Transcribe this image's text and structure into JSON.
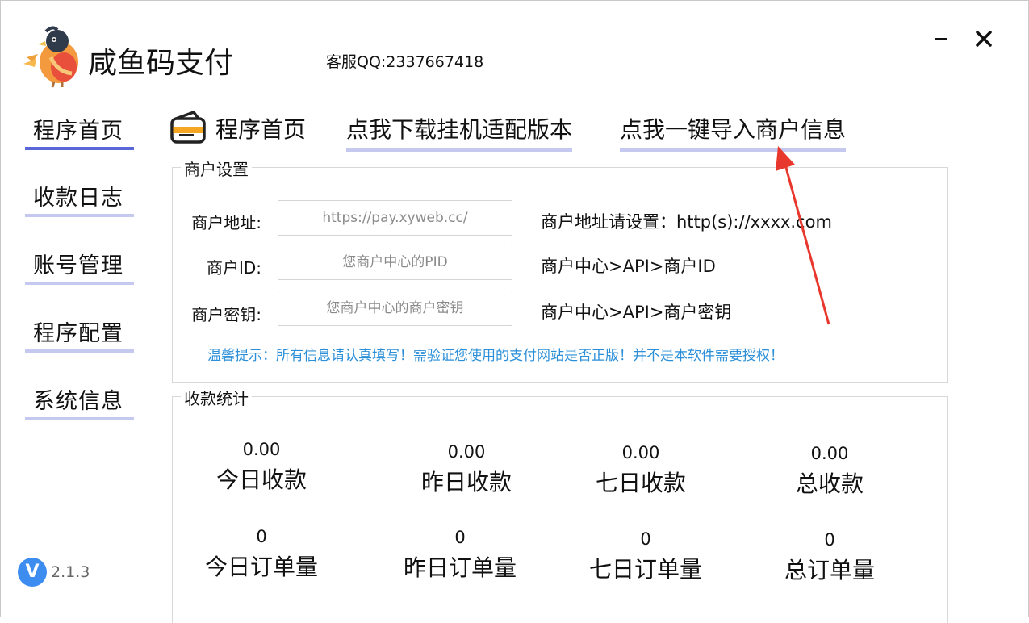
{
  "app": {
    "title": "咸鱼码支付",
    "support": "客服QQ:2337667418",
    "version": "2.1.3",
    "version_icon": "V"
  },
  "window_controls": {
    "minimize_icon": "minimize-icon",
    "close_icon": "close-icon"
  },
  "sidebar": {
    "items": [
      {
        "label": "程序首页",
        "active": true
      },
      {
        "label": "收款日志",
        "active": false
      },
      {
        "label": "账号管理",
        "active": false
      },
      {
        "label": "程序配置",
        "active": false
      },
      {
        "label": "系统信息",
        "active": false
      }
    ]
  },
  "tabs": {
    "home": "程序首页",
    "download": "点我下载挂机适配版本",
    "import": "点我一键导入商户信息"
  },
  "merchant": {
    "title": "商户设置",
    "fields": [
      {
        "label": "商户地址:",
        "placeholder": "https://pay.xyweb.cc/",
        "hint": "商户地址请设置：http(s)://xxxx.com"
      },
      {
        "label": "商户ID:",
        "placeholder": "您商户中心的PID",
        "hint": "商户中心>API>商户ID"
      },
      {
        "label": "商户密钥:",
        "placeholder": "您商户中心的商户密钥",
        "hint": "商户中心>API>商户密钥"
      }
    ],
    "tip": "温馨提示：所有信息请认真填写！需验证您使用的支付网站是否正版！并不是本软件需要授权！"
  },
  "stats": {
    "title": "收款统计",
    "amounts": [
      {
        "value": "0.00",
        "label": "今日收款"
      },
      {
        "value": "0.00",
        "label": "昨日收款"
      },
      {
        "value": "0.00",
        "label": "七日收款"
      },
      {
        "value": "0.00",
        "label": "总收款"
      }
    ],
    "orders": [
      {
        "value": "0",
        "label": "今日订单量"
      },
      {
        "value": "0",
        "label": "昨日订单量"
      },
      {
        "value": "0",
        "label": "七日订单量"
      },
      {
        "value": "0",
        "label": "总订单量"
      }
    ]
  },
  "colors": {
    "accent": "#5a67d8",
    "underline": "#c5c9ef",
    "tip": "#2a8fd8",
    "arrow": "#e8372c",
    "version_badge": "#3d8cf0"
  }
}
